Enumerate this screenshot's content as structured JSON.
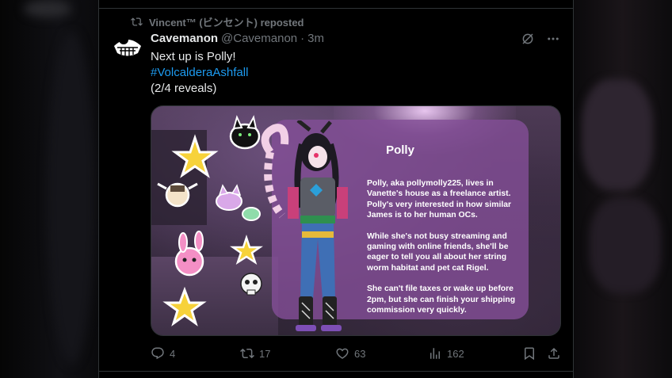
{
  "repost": {
    "text": "Vincent™ (ビンセント) reposted",
    "icon": "repost-icon"
  },
  "tweet": {
    "name": "Cavemanon",
    "handle": "@Cavemanon",
    "dot": "·",
    "time": "3m",
    "line1": "Next up is Polly!",
    "hashtag": "#VolcalderaAshfall",
    "line3": "(2/4 reveals)"
  },
  "media": {
    "card_title": "Polly",
    "paragraphs": [
      "Polly, aka pollymolly225, lives in Vanette's house as a freelance artist. Polly's very interested in how similar James is to her human OCs.",
      "While she's not busy streaming and gaming with online friends, she'll be eager to tell you all about her string worm habitat and pet cat Rigel.",
      "She can't file taxes or wake up before 2pm, but she can finish your shipping commission very quickly."
    ]
  },
  "actions": {
    "replies": "4",
    "reposts": "17",
    "likes": "63",
    "views": "162"
  },
  "colors": {
    "accent": "#1d9bf0",
    "muted": "#71767b",
    "text": "#e7e9ea",
    "border": "#2f3336"
  }
}
